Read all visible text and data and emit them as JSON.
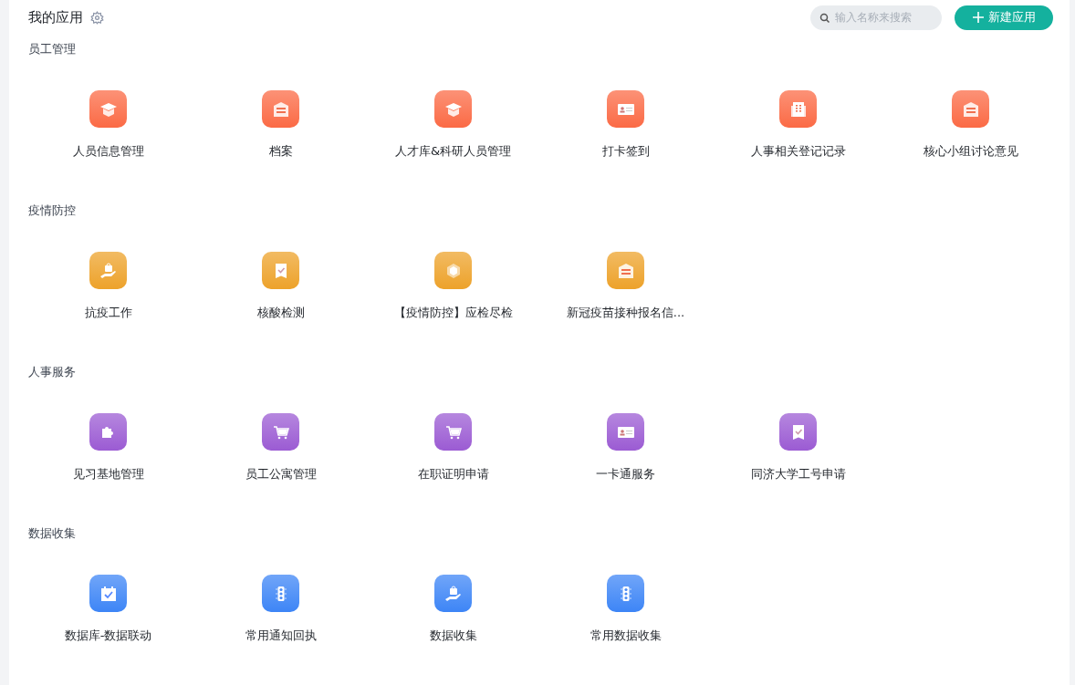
{
  "header": {
    "title": "我的应用",
    "search": {
      "placeholder": "输入名称来搜索"
    },
    "new_button": "新建应用"
  },
  "groups": [
    {
      "title": "员工管理",
      "color": "#fb6a45",
      "apps": [
        {
          "name": "人员信息管理",
          "kind": "cap"
        },
        {
          "name": "档案",
          "kind": "archive"
        },
        {
          "name": "人才库&科研人员管理",
          "kind": "cap"
        },
        {
          "name": "打卡签到",
          "kind": "idcard"
        },
        {
          "name": "人事相关登记记录",
          "kind": "building"
        },
        {
          "name": "核心小组讨论意见",
          "kind": "archive"
        }
      ]
    },
    {
      "title": "疫情防控",
      "color": "#eda22a",
      "apps": [
        {
          "name": "抗疫工作",
          "kind": "handbag"
        },
        {
          "name": "核酸检测",
          "kind": "ribbon"
        },
        {
          "name": "【疫情防控】应检尽检",
          "kind": "cube"
        },
        {
          "name": "新冠疫苗接种报名信...",
          "kind": "archive"
        }
      ]
    },
    {
      "title": "人事服务",
      "color": "#9b5bd3",
      "apps": [
        {
          "name": "见习基地管理",
          "kind": "puzzle"
        },
        {
          "name": "员工公寓管理",
          "kind": "cart"
        },
        {
          "name": "在职证明申请",
          "kind": "cart"
        },
        {
          "name": "一卡通服务",
          "kind": "idcard"
        },
        {
          "name": "同济大学工号申请",
          "kind": "ribbon"
        }
      ]
    },
    {
      "title": "数据收集",
      "color": "#3d85f6",
      "apps": [
        {
          "name": "数据库-数据联动",
          "kind": "calendar"
        },
        {
          "name": "常用通知回执",
          "kind": "traffic"
        },
        {
          "name": "数据收集",
          "kind": "handbag"
        },
        {
          "name": "常用数据收集",
          "kind": "traffic"
        }
      ]
    }
  ]
}
